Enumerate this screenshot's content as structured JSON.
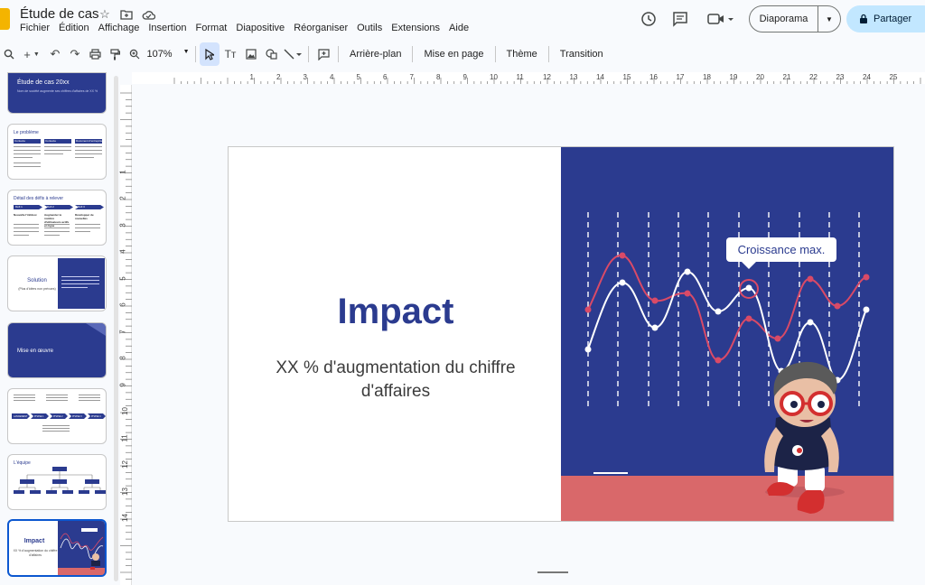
{
  "app": {
    "doc_title": "Étude de cas",
    "menu": [
      "Fichier",
      "Édition",
      "Affichage",
      "Insertion",
      "Format",
      "Diapositive",
      "Réorganiser",
      "Outils",
      "Extensions",
      "Aide"
    ],
    "slideshow_label": "Diaporama",
    "share_label": "Partager"
  },
  "toolbar": {
    "zoom": "107%",
    "background": "Arrière-plan",
    "layout": "Mise en page",
    "theme": "Thème",
    "transition": "Transition"
  },
  "thumbnails": [
    {
      "title": "Étude de cas 20xx",
      "text": "Nom de société augmente ses chiffres d'affaires de XX %"
    },
    {
      "title": "Le problème",
      "cols": [
        "Contexte",
        "Contexte",
        "Document d'entreprise"
      ]
    },
    {
      "title": "Détail des défis à relever",
      "steps": [
        "Défi 1",
        "Défi 2",
        "Défi 3"
      ],
      "heads": [
        "Nouvelle l'infobox",
        "Augmenter le nombre d'utilisateurs actifs en ligne",
        "Développer de nouvelles"
      ]
    },
    {
      "title": "Solution",
      "text": "(Plus d'idées non prévues)"
    },
    {
      "title": "Mise en œuvre"
    },
    {
      "steps": [
        "LANCEMENT",
        "PHASE 1",
        "PHASE 2",
        "PHASE 3",
        "PHASE 4"
      ]
    },
    {
      "title": "L'équipe"
    },
    {
      "title": "Impact",
      "text": "XX % d'augmentation du chiffre d'affaires"
    }
  ],
  "slide": {
    "title": "Impact",
    "subtitle": "XX % d'augmentation du chiffre d'affaires",
    "callout": "Croissance max.",
    "colors": {
      "panel": "#2b3b8f",
      "floor": "#d9686a",
      "red_line": "#d94a67",
      "white_line": "#ffffff",
      "title": "#2b3b8f"
    }
  },
  "ruler": {
    "h": [
      "1",
      "2",
      "3",
      "4",
      "5",
      "6",
      "7",
      "8",
      "9",
      "10",
      "11",
      "12",
      "13",
      "14",
      "15",
      "16",
      "17",
      "18",
      "19",
      "20",
      "21",
      "22",
      "23",
      "24",
      "25"
    ],
    "v": [
      "1",
      "2",
      "3",
      "4",
      "5",
      "6",
      "7",
      "8",
      "9",
      "10",
      "11",
      "12",
      "13",
      "14"
    ]
  }
}
